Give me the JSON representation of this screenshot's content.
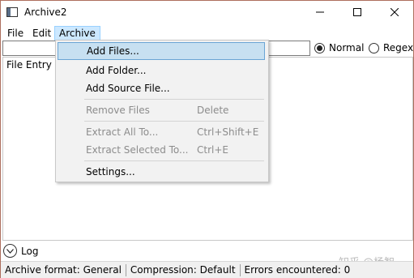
{
  "window": {
    "title": "Archive2",
    "controls": {
      "minimize": "minimize-icon",
      "maximize": "maximize-icon",
      "close": "close-icon"
    }
  },
  "menubar": {
    "items": [
      {
        "label": "File"
      },
      {
        "label": "Edit"
      },
      {
        "label": "Archive"
      }
    ]
  },
  "search": {
    "value": "",
    "mode_normal_label": "Normal",
    "mode_regex_label": "Regex",
    "selected_mode": "Normal"
  },
  "list": {
    "header_visible": "File Entry N"
  },
  "archive_menu": {
    "items": [
      {
        "label": "Add Files...",
        "shortcut": "",
        "enabled": true,
        "highlighted": true
      },
      {
        "label": "Add Folder...",
        "shortcut": "",
        "enabled": true
      },
      {
        "label": "Add Source File...",
        "shortcut": "",
        "enabled": true
      },
      {
        "label": "Remove Files",
        "shortcut": "Delete",
        "enabled": false
      },
      {
        "label": "Extract All To...",
        "shortcut": "Ctrl+Shift+E",
        "enabled": false
      },
      {
        "label": "Extract Selected To...",
        "shortcut": "Ctrl+E",
        "enabled": false
      },
      {
        "label": "Settings...",
        "shortcut": "",
        "enabled": true
      }
    ]
  },
  "log": {
    "label": "Log",
    "icon": "chevron-down-circle-icon"
  },
  "status": {
    "archive_format_label": "Archive format:",
    "archive_format_value": "General",
    "compression_label": "Compression:",
    "compression_value": "Default",
    "errors_label": "Errors encountered:",
    "errors_value": "0"
  },
  "watermark": "知乎 @杨智",
  "colors": {
    "window_border": "#ad6f5e",
    "menu_active_bg": "#cce8ff",
    "menu_item_highlight_bg": "#c7e0f1",
    "disabled_text": "#8c8c8c",
    "statusbar_bg": "#f0f0f0"
  }
}
